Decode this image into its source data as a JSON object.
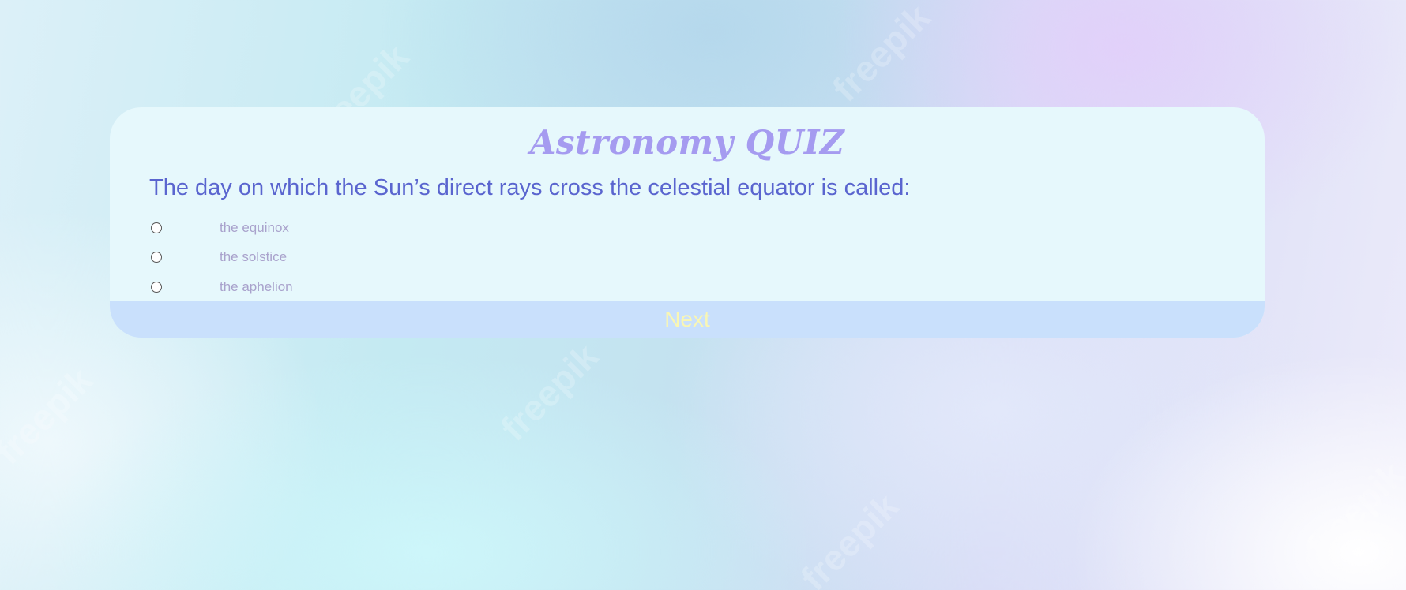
{
  "quiz": {
    "title": "Astronomy QUIZ",
    "question": "The day on which the Sun’s direct rays cross the celestial equator is called:",
    "answers": [
      {
        "label": "the equinox"
      },
      {
        "label": "the solstice"
      },
      {
        "label": "the aphelion"
      }
    ],
    "next_label": "Next"
  },
  "watermark": {
    "text": "freepik"
  },
  "colors": {
    "title": "#a59bf0",
    "question": "#5a65cf",
    "answer": "#a9a2cc",
    "card": "#e6f8fc",
    "next_bar": "#c9e0fc",
    "next_text": "#f9f6b3"
  }
}
